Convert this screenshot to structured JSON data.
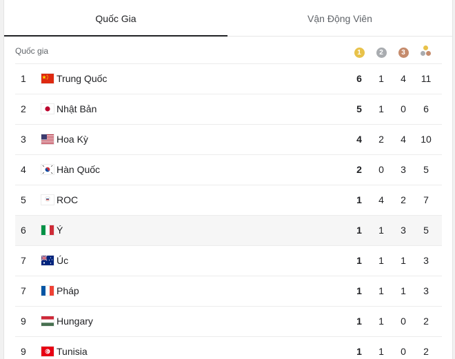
{
  "tabs": [
    {
      "label": "Quốc Gia",
      "active": true
    },
    {
      "label": "Vận Động Viên",
      "active": false
    }
  ],
  "header": {
    "country_label": "Quốc gia",
    "medals": {
      "gold": "1",
      "silver": "2",
      "bronze": "3"
    }
  },
  "rows": [
    {
      "rank": "1",
      "country": "Trung Quốc",
      "flag": "china-flag",
      "gold": "6",
      "silver": "1",
      "bronze": "4",
      "total": "11"
    },
    {
      "rank": "2",
      "country": "Nhật Bản",
      "flag": "japan-flag",
      "gold": "5",
      "silver": "1",
      "bronze": "0",
      "total": "6"
    },
    {
      "rank": "3",
      "country": "Hoa Kỳ",
      "flag": "usa-flag",
      "gold": "4",
      "silver": "2",
      "bronze": "4",
      "total": "10"
    },
    {
      "rank": "4",
      "country": "Hàn Quốc",
      "flag": "korea-flag",
      "gold": "2",
      "silver": "0",
      "bronze": "3",
      "total": "5"
    },
    {
      "rank": "5",
      "country": "ROC",
      "flag": "roc-flag",
      "gold": "1",
      "silver": "4",
      "bronze": "2",
      "total": "7"
    },
    {
      "rank": "6",
      "country": "Ý",
      "flag": "italy-flag",
      "gold": "1",
      "silver": "1",
      "bronze": "3",
      "total": "5"
    },
    {
      "rank": "7",
      "country": "Úc",
      "flag": "australia-flag",
      "gold": "1",
      "silver": "1",
      "bronze": "1",
      "total": "3"
    },
    {
      "rank": "7",
      "country": "Pháp",
      "flag": "france-flag",
      "gold": "1",
      "silver": "1",
      "bronze": "1",
      "total": "3"
    },
    {
      "rank": "9",
      "country": "Hungary",
      "flag": "hungary-flag",
      "gold": "1",
      "silver": "1",
      "bronze": "0",
      "total": "2"
    },
    {
      "rank": "9",
      "country": "Tunisia",
      "flag": "tunisia-flag",
      "gold": "1",
      "silver": "1",
      "bronze": "0",
      "total": "2"
    }
  ],
  "colors": {
    "gold": "#e8c24a",
    "silver": "#a9acb0",
    "bronze": "#c58b6c",
    "active_tab_underline": "#202124",
    "highlight_row": "#f6f6f6"
  }
}
